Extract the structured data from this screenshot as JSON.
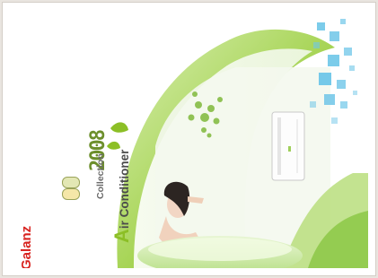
{
  "poster": {
    "brand": "Galanz",
    "title_initial": "A",
    "title_rest": "ir Conditioner",
    "year": "2008",
    "collection": "Collection",
    "badge_1": "",
    "badge_2": ""
  },
  "colors": {
    "accent_green": "#8cbf26",
    "light_green": "#c9e89a",
    "brand_red": "#d8231f",
    "blue_square": "#6ec6e8"
  },
  "icons": [
    "leaf-decoration",
    "air-conditioner-unit",
    "woman-photo",
    "blue-square-pattern",
    "energy-badge"
  ]
}
